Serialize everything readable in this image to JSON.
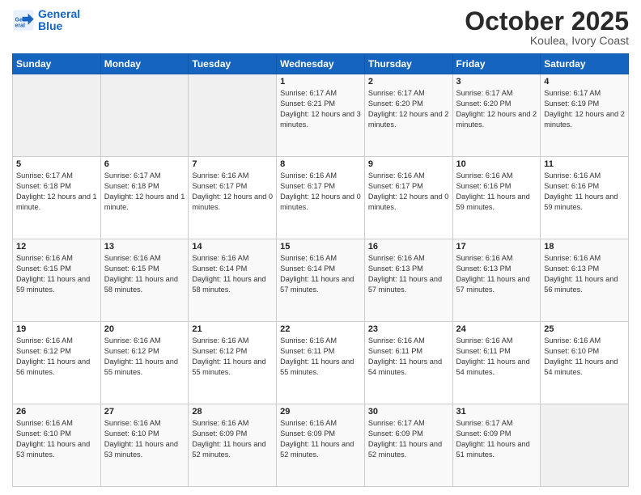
{
  "header": {
    "logo_general": "General",
    "logo_blue": "Blue",
    "month": "October 2025",
    "location": "Koulea, Ivory Coast"
  },
  "weekdays": [
    "Sunday",
    "Monday",
    "Tuesday",
    "Wednesday",
    "Thursday",
    "Friday",
    "Saturday"
  ],
  "weeks": [
    [
      {
        "day": "",
        "info": ""
      },
      {
        "day": "",
        "info": ""
      },
      {
        "day": "",
        "info": ""
      },
      {
        "day": "1",
        "info": "Sunrise: 6:17 AM\nSunset: 6:21 PM\nDaylight: 12 hours and 3 minutes."
      },
      {
        "day": "2",
        "info": "Sunrise: 6:17 AM\nSunset: 6:20 PM\nDaylight: 12 hours and 2 minutes."
      },
      {
        "day": "3",
        "info": "Sunrise: 6:17 AM\nSunset: 6:20 PM\nDaylight: 12 hours and 2 minutes."
      },
      {
        "day": "4",
        "info": "Sunrise: 6:17 AM\nSunset: 6:19 PM\nDaylight: 12 hours and 2 minutes."
      }
    ],
    [
      {
        "day": "5",
        "info": "Sunrise: 6:17 AM\nSunset: 6:18 PM\nDaylight: 12 hours and 1 minute."
      },
      {
        "day": "6",
        "info": "Sunrise: 6:17 AM\nSunset: 6:18 PM\nDaylight: 12 hours and 1 minute."
      },
      {
        "day": "7",
        "info": "Sunrise: 6:16 AM\nSunset: 6:17 PM\nDaylight: 12 hours and 0 minutes."
      },
      {
        "day": "8",
        "info": "Sunrise: 6:16 AM\nSunset: 6:17 PM\nDaylight: 12 hours and 0 minutes."
      },
      {
        "day": "9",
        "info": "Sunrise: 6:16 AM\nSunset: 6:17 PM\nDaylight: 12 hours and 0 minutes."
      },
      {
        "day": "10",
        "info": "Sunrise: 6:16 AM\nSunset: 6:16 PM\nDaylight: 11 hours and 59 minutes."
      },
      {
        "day": "11",
        "info": "Sunrise: 6:16 AM\nSunset: 6:16 PM\nDaylight: 11 hours and 59 minutes."
      }
    ],
    [
      {
        "day": "12",
        "info": "Sunrise: 6:16 AM\nSunset: 6:15 PM\nDaylight: 11 hours and 59 minutes."
      },
      {
        "day": "13",
        "info": "Sunrise: 6:16 AM\nSunset: 6:15 PM\nDaylight: 11 hours and 58 minutes."
      },
      {
        "day": "14",
        "info": "Sunrise: 6:16 AM\nSunset: 6:14 PM\nDaylight: 11 hours and 58 minutes."
      },
      {
        "day": "15",
        "info": "Sunrise: 6:16 AM\nSunset: 6:14 PM\nDaylight: 11 hours and 57 minutes."
      },
      {
        "day": "16",
        "info": "Sunrise: 6:16 AM\nSunset: 6:13 PM\nDaylight: 11 hours and 57 minutes."
      },
      {
        "day": "17",
        "info": "Sunrise: 6:16 AM\nSunset: 6:13 PM\nDaylight: 11 hours and 57 minutes."
      },
      {
        "day": "18",
        "info": "Sunrise: 6:16 AM\nSunset: 6:13 PM\nDaylight: 11 hours and 56 minutes."
      }
    ],
    [
      {
        "day": "19",
        "info": "Sunrise: 6:16 AM\nSunset: 6:12 PM\nDaylight: 11 hours and 56 minutes."
      },
      {
        "day": "20",
        "info": "Sunrise: 6:16 AM\nSunset: 6:12 PM\nDaylight: 11 hours and 55 minutes."
      },
      {
        "day": "21",
        "info": "Sunrise: 6:16 AM\nSunset: 6:12 PM\nDaylight: 11 hours and 55 minutes."
      },
      {
        "day": "22",
        "info": "Sunrise: 6:16 AM\nSunset: 6:11 PM\nDaylight: 11 hours and 55 minutes."
      },
      {
        "day": "23",
        "info": "Sunrise: 6:16 AM\nSunset: 6:11 PM\nDaylight: 11 hours and 54 minutes."
      },
      {
        "day": "24",
        "info": "Sunrise: 6:16 AM\nSunset: 6:11 PM\nDaylight: 11 hours and 54 minutes."
      },
      {
        "day": "25",
        "info": "Sunrise: 6:16 AM\nSunset: 6:10 PM\nDaylight: 11 hours and 54 minutes."
      }
    ],
    [
      {
        "day": "26",
        "info": "Sunrise: 6:16 AM\nSunset: 6:10 PM\nDaylight: 11 hours and 53 minutes."
      },
      {
        "day": "27",
        "info": "Sunrise: 6:16 AM\nSunset: 6:10 PM\nDaylight: 11 hours and 53 minutes."
      },
      {
        "day": "28",
        "info": "Sunrise: 6:16 AM\nSunset: 6:09 PM\nDaylight: 11 hours and 52 minutes."
      },
      {
        "day": "29",
        "info": "Sunrise: 6:16 AM\nSunset: 6:09 PM\nDaylight: 11 hours and 52 minutes."
      },
      {
        "day": "30",
        "info": "Sunrise: 6:17 AM\nSunset: 6:09 PM\nDaylight: 11 hours and 52 minutes."
      },
      {
        "day": "31",
        "info": "Sunrise: 6:17 AM\nSunset: 6:09 PM\nDaylight: 11 hours and 51 minutes."
      },
      {
        "day": "",
        "info": ""
      }
    ]
  ]
}
